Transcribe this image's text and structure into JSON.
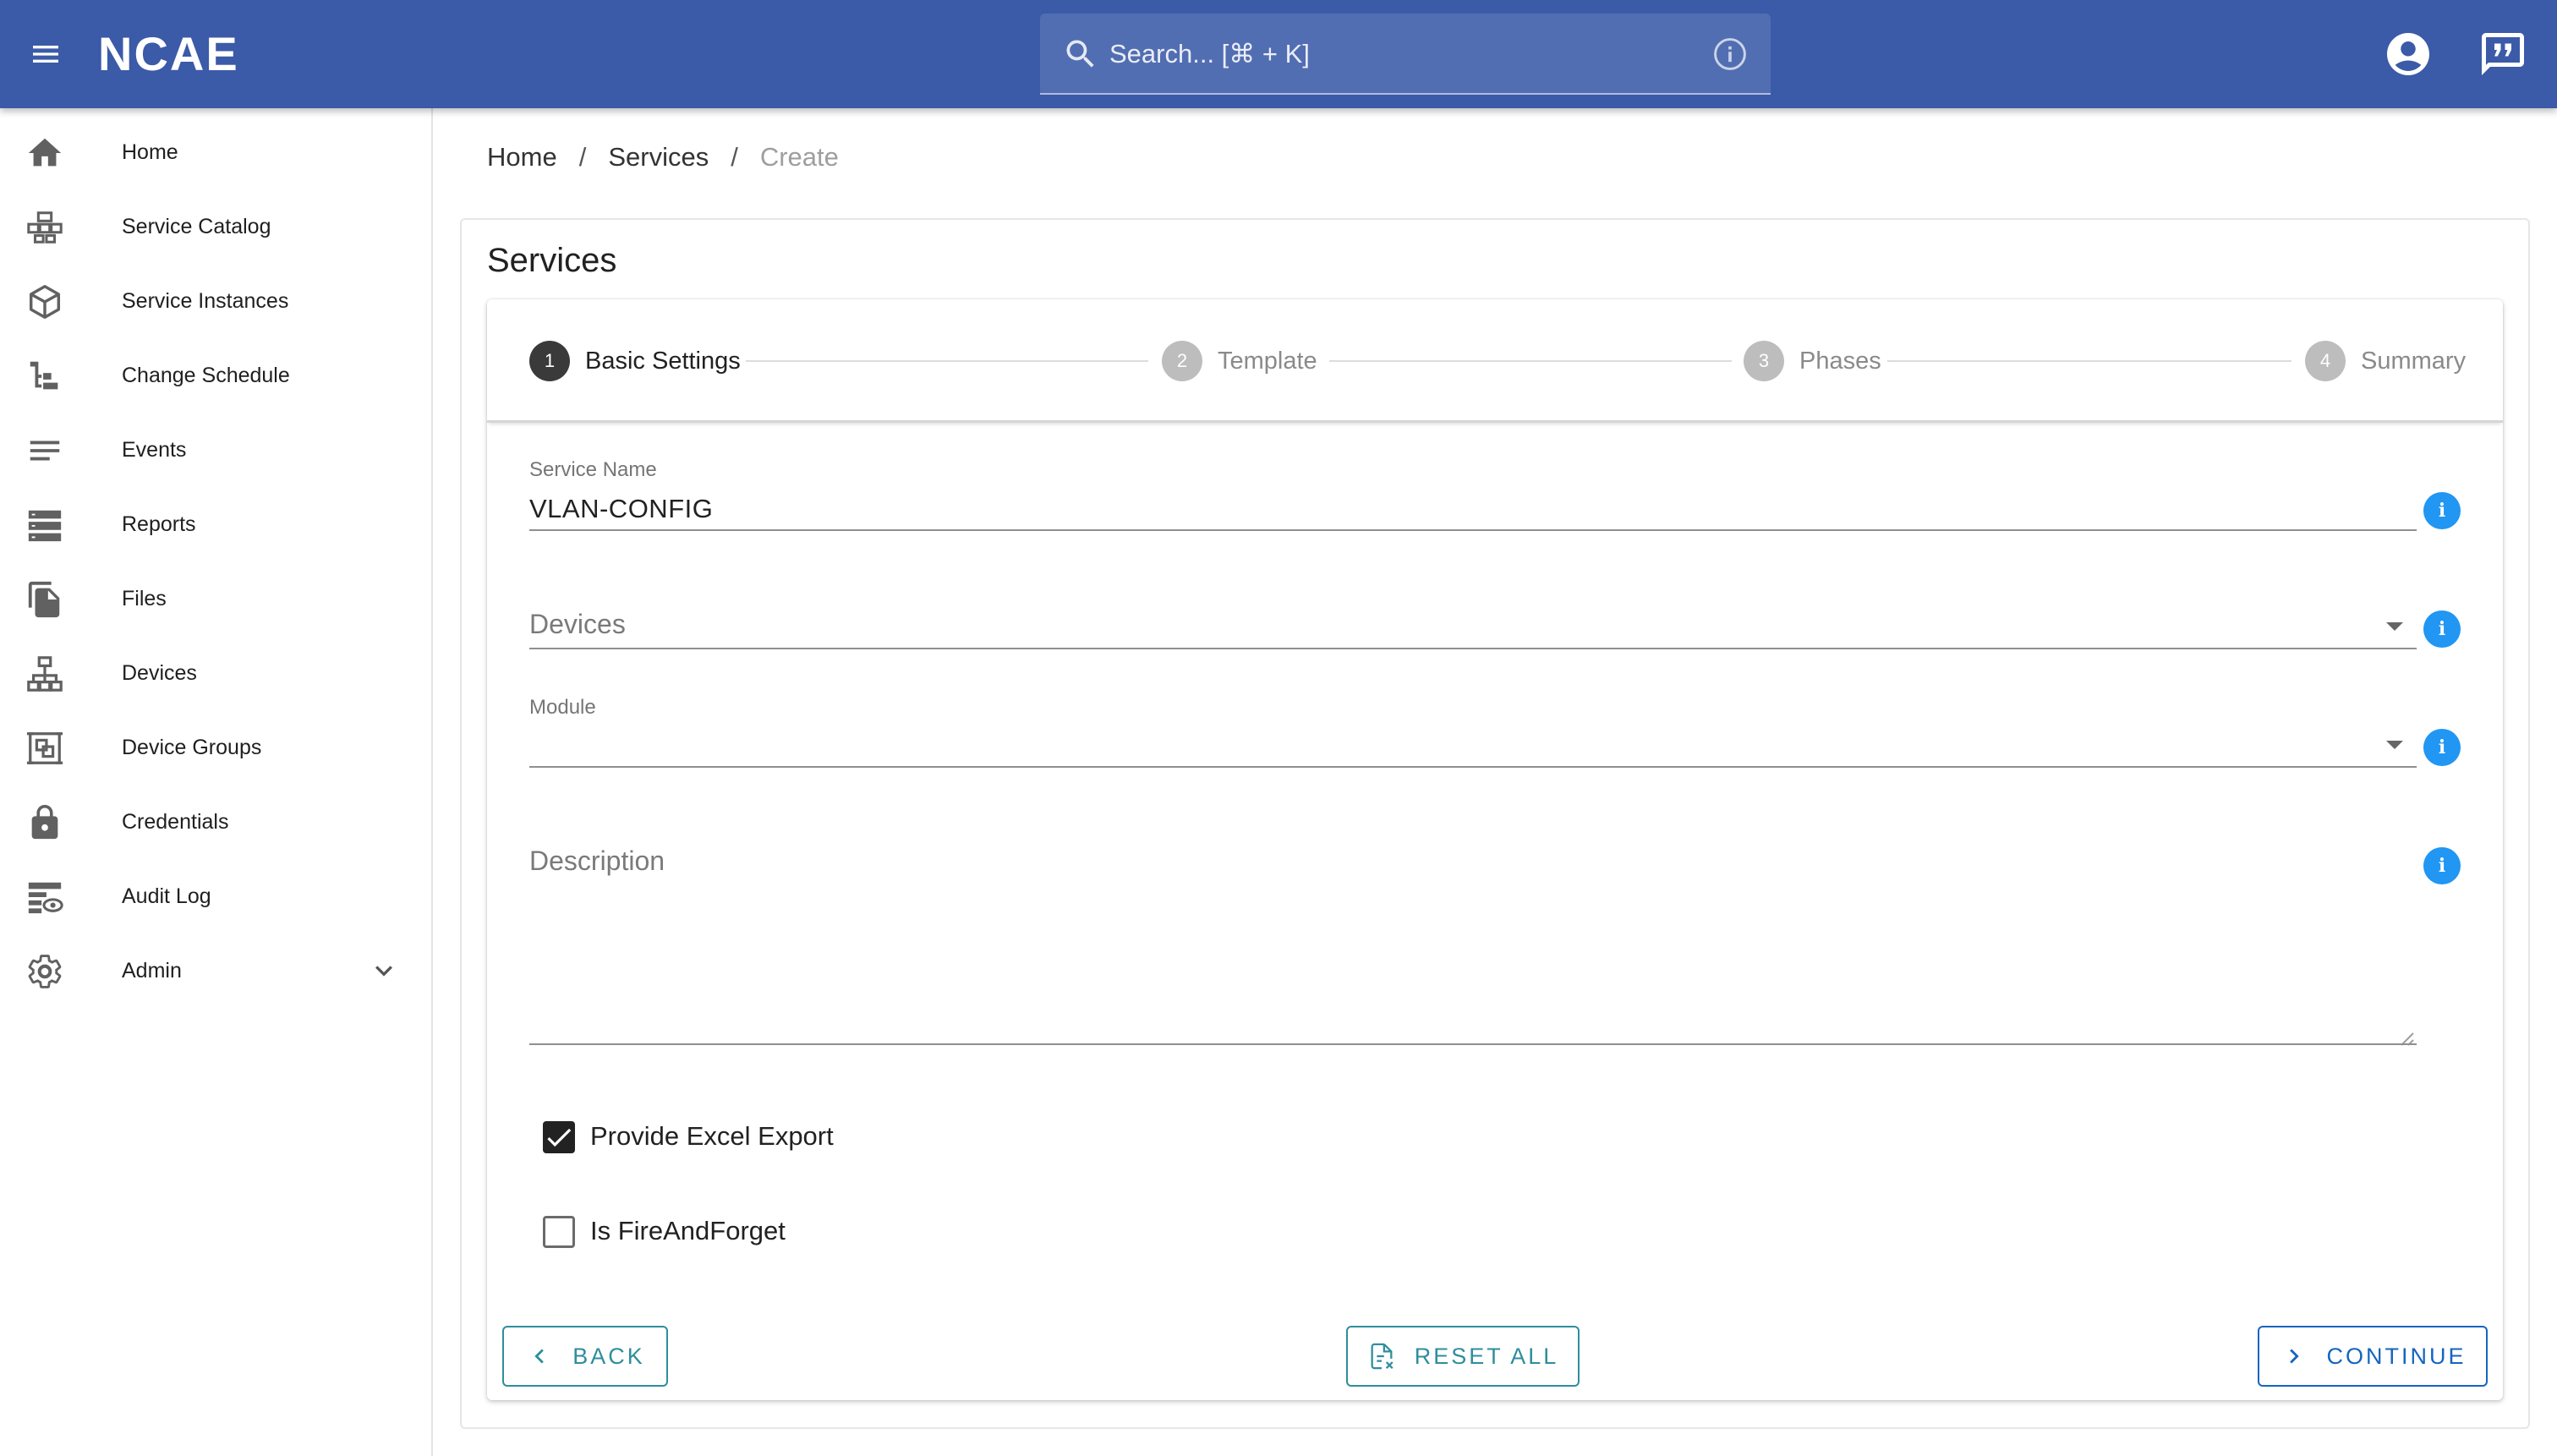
{
  "app": {
    "logo_text": "NCAE",
    "search_placeholder": "Search... [⌘ + K]",
    "brand_color": "#3b5aa8"
  },
  "sidebar": {
    "items": [
      {
        "label": "Home",
        "icon": "home-icon"
      },
      {
        "label": "Service Catalog",
        "icon": "service-catalog-icon"
      },
      {
        "label": "Service Instances",
        "icon": "cube-icon"
      },
      {
        "label": "Change Schedule",
        "icon": "schedule-tree-icon"
      },
      {
        "label": "Events",
        "icon": "list-lines-icon"
      },
      {
        "label": "Reports",
        "icon": "reports-icon"
      },
      {
        "label": "Files",
        "icon": "files-icon"
      },
      {
        "label": "Devices",
        "icon": "device-tree-icon"
      },
      {
        "label": "Device Groups",
        "icon": "device-groups-icon"
      },
      {
        "label": "Credentials",
        "icon": "lock-icon"
      },
      {
        "label": "Audit Log",
        "icon": "audit-log-icon"
      },
      {
        "label": "Admin",
        "icon": "gear-icon"
      }
    ]
  },
  "breadcrumb": {
    "home": "Home",
    "sep": "/",
    "services": "Services",
    "current": "Create"
  },
  "page": {
    "title": "Services"
  },
  "stepper": {
    "steps": [
      {
        "number": "1",
        "label": "Basic Settings",
        "state": "active"
      },
      {
        "number": "2",
        "label": "Template",
        "state": "inactive"
      },
      {
        "number": "3",
        "label": "Phases",
        "state": "inactive"
      },
      {
        "number": "4",
        "label": "Summary",
        "state": "inactive"
      }
    ]
  },
  "form": {
    "service_name_label": "Service Name",
    "service_name_value": "VLAN-CONFIG",
    "devices_placeholder": "Devices",
    "module_label": "Module",
    "module_value": "",
    "description_placeholder": "Description",
    "info_glyph": "i",
    "excel_export_label": "Provide Excel Export",
    "excel_export_checked": true,
    "fire_and_forget_label": "Is FireAndForget",
    "fire_and_forget_checked": false
  },
  "buttons": {
    "back": "BACK",
    "reset_all": "RESET ALL",
    "continue": "CONTINUE"
  },
  "colors": {
    "info": "#2196f3",
    "teal": "#2e8e9c",
    "continue_blue": "#1565c0"
  }
}
